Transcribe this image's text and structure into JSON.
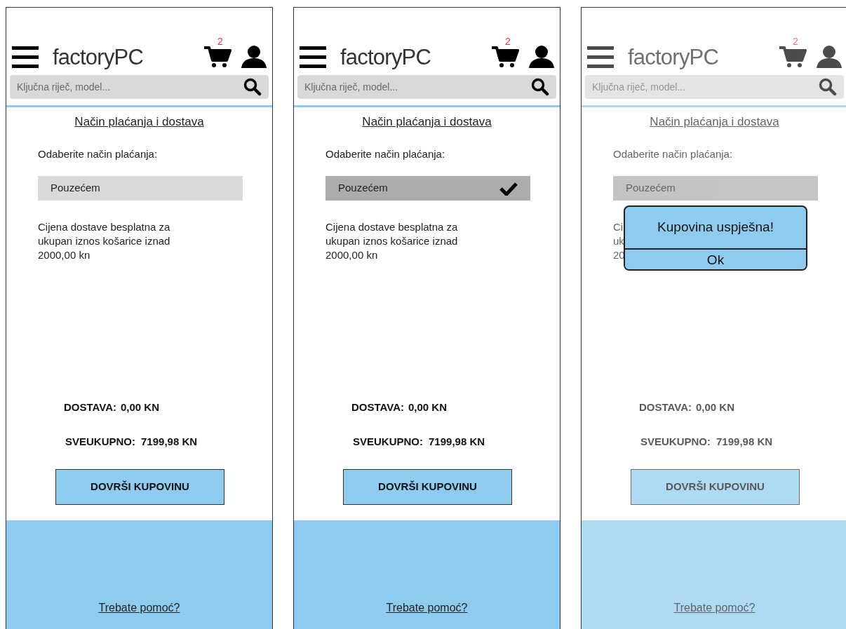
{
  "screens": [
    {
      "blurred": false,
      "logo": "factoryPC",
      "cart_count": "2",
      "search": {
        "placeholder": "Ključna riječ, model..."
      },
      "title": "Način plaćanja i dostava",
      "payment_label": "Odaberite način plaćanja:",
      "option": {
        "label": "Pouzećem",
        "selected": false,
        "check_shown": false
      },
      "note": [
        "Cijena dostave besplatna za",
        "ukupan iznos košarice iznad",
        "2000,00 kn"
      ],
      "delivery": {
        "label": "DOSTAVA:",
        "value": "0,00 KN"
      },
      "total": {
        "label": "SVEUKUPNO:",
        "value": "7199,98 KN"
      },
      "finish_button": "DOVRŠI KUPOVINU",
      "help_link": "Trebate pomoć?"
    },
    {
      "blurred": false,
      "logo": "factoryPC",
      "cart_count": "2",
      "search": {
        "placeholder": "Ključna riječ, model..."
      },
      "title": "Način plaćanja i dostava",
      "payment_label": "Odaberite način plaćanja:",
      "option": {
        "label": "Pouzećem",
        "selected": true,
        "check_shown": true
      },
      "note": [
        "Cijena dostave besplatna za",
        "ukupan iznos košarice iznad",
        "2000,00 kn"
      ],
      "delivery": {
        "label": "DOSTAVA:",
        "value": "0,00 KN"
      },
      "total": {
        "label": "SVEUKUPNO:",
        "value": "7199,98 KN"
      },
      "finish_button": "DOVRŠI KUPOVINU",
      "help_link": "Trebate pomoć?"
    },
    {
      "blurred": true,
      "logo": "factoryPC",
      "cart_count": "2",
      "search": {
        "placeholder": "Ključna riječ, model..."
      },
      "title": "Način plaćanja i dostava",
      "payment_label": "Odaberite način plaćanja:",
      "option": {
        "label": "Pouzećem",
        "selected": true,
        "check_shown": false
      },
      "note": [
        "Ci",
        "uk",
        "20"
      ],
      "delivery": {
        "label": "DOSTAVA:",
        "value": "0,00 KN"
      },
      "total": {
        "label": "SVEUKUPNO:",
        "value": "7199,98 KN"
      },
      "finish_button": "DOVRŠI KUPOVINU",
      "help_link": "Trebate pomoć?",
      "dialog": {
        "message": "Kupovina uspješna!",
        "button": "Ok"
      }
    }
  ]
}
